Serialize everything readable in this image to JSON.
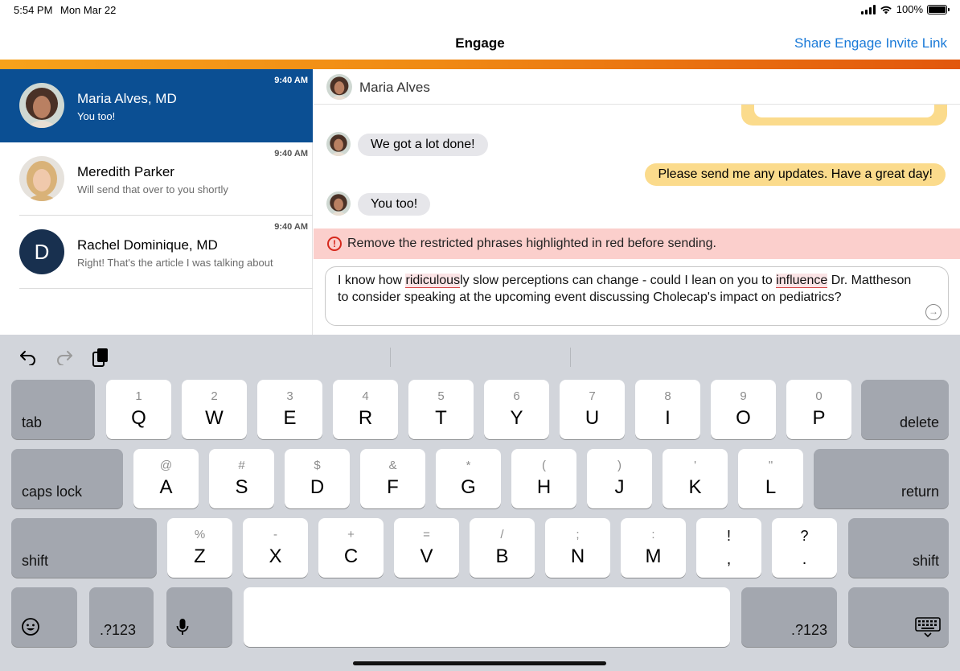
{
  "status_bar": {
    "time": "5:54 PM",
    "date": "Mon Mar 22",
    "battery": "100%"
  },
  "nav": {
    "title": "Engage",
    "share_link": "Share Engage Invite Link"
  },
  "conversations": [
    {
      "name": "Maria Alves, MD",
      "preview": "You too!",
      "time": "9:40 AM",
      "active": true
    },
    {
      "name": "Meredith Parker",
      "preview": "Will send that over to you shortly",
      "time": "9:40 AM"
    },
    {
      "name": "Rachel Dominique, MD",
      "preview": "Right! That's the article I was talking about",
      "time": "9:40 AM",
      "initial": "D"
    }
  ],
  "chat": {
    "header_name": "Maria Alves",
    "messages": [
      {
        "from": "them",
        "text": "We got a lot done!"
      },
      {
        "from": "me",
        "text": "Please send me any updates. Have a great day!"
      },
      {
        "from": "them",
        "text": "You too!"
      }
    ],
    "warning": "Remove the restricted phrases highlighted in red before sending.",
    "composer": {
      "t1": "I know how ",
      "hl1": "ridiculous",
      "t2": "ly slow perceptions can change - could I lean on you to ",
      "hl2": "influence",
      "t3": " Dr. Mattheson to consider speaking at the upcoming event discussing Cholecap's impact on pediatrics?"
    }
  },
  "keyboard": {
    "row1": [
      [
        "1",
        "Q"
      ],
      [
        "2",
        "W"
      ],
      [
        "3",
        "E"
      ],
      [
        "4",
        "R"
      ],
      [
        "5",
        "T"
      ],
      [
        "6",
        "Y"
      ],
      [
        "7",
        "U"
      ],
      [
        "8",
        "I"
      ],
      [
        "9",
        "O"
      ],
      [
        "0",
        "P"
      ]
    ],
    "row2": [
      [
        "@",
        "A"
      ],
      [
        "#",
        "S"
      ],
      [
        "$",
        "D"
      ],
      [
        "&",
        "F"
      ],
      [
        "*",
        "G"
      ],
      [
        "(",
        "H"
      ],
      [
        ")",
        "J"
      ],
      [
        "'",
        "K"
      ],
      [
        "\"",
        "L"
      ]
    ],
    "row3": [
      [
        "%",
        "Z"
      ],
      [
        "-",
        "X"
      ],
      [
        "+",
        "C"
      ],
      [
        "=",
        "V"
      ],
      [
        "/",
        "B"
      ],
      [
        ";",
        "N"
      ],
      [
        ":",
        "M"
      ]
    ],
    "punct": [
      [
        "!",
        ","
      ],
      [
        "?",
        "."
      ]
    ],
    "tab": "tab",
    "delete": "delete",
    "caps_lock": "caps lock",
    "return": "return",
    "shift": "shift",
    "numbers": ".?123"
  },
  "colors": {
    "accent_blue": "#0b4f93",
    "link_blue": "#1a7ad8",
    "outgoing_bubble": "#fbdb8c",
    "warning_bg": "#fbcfcc"
  }
}
